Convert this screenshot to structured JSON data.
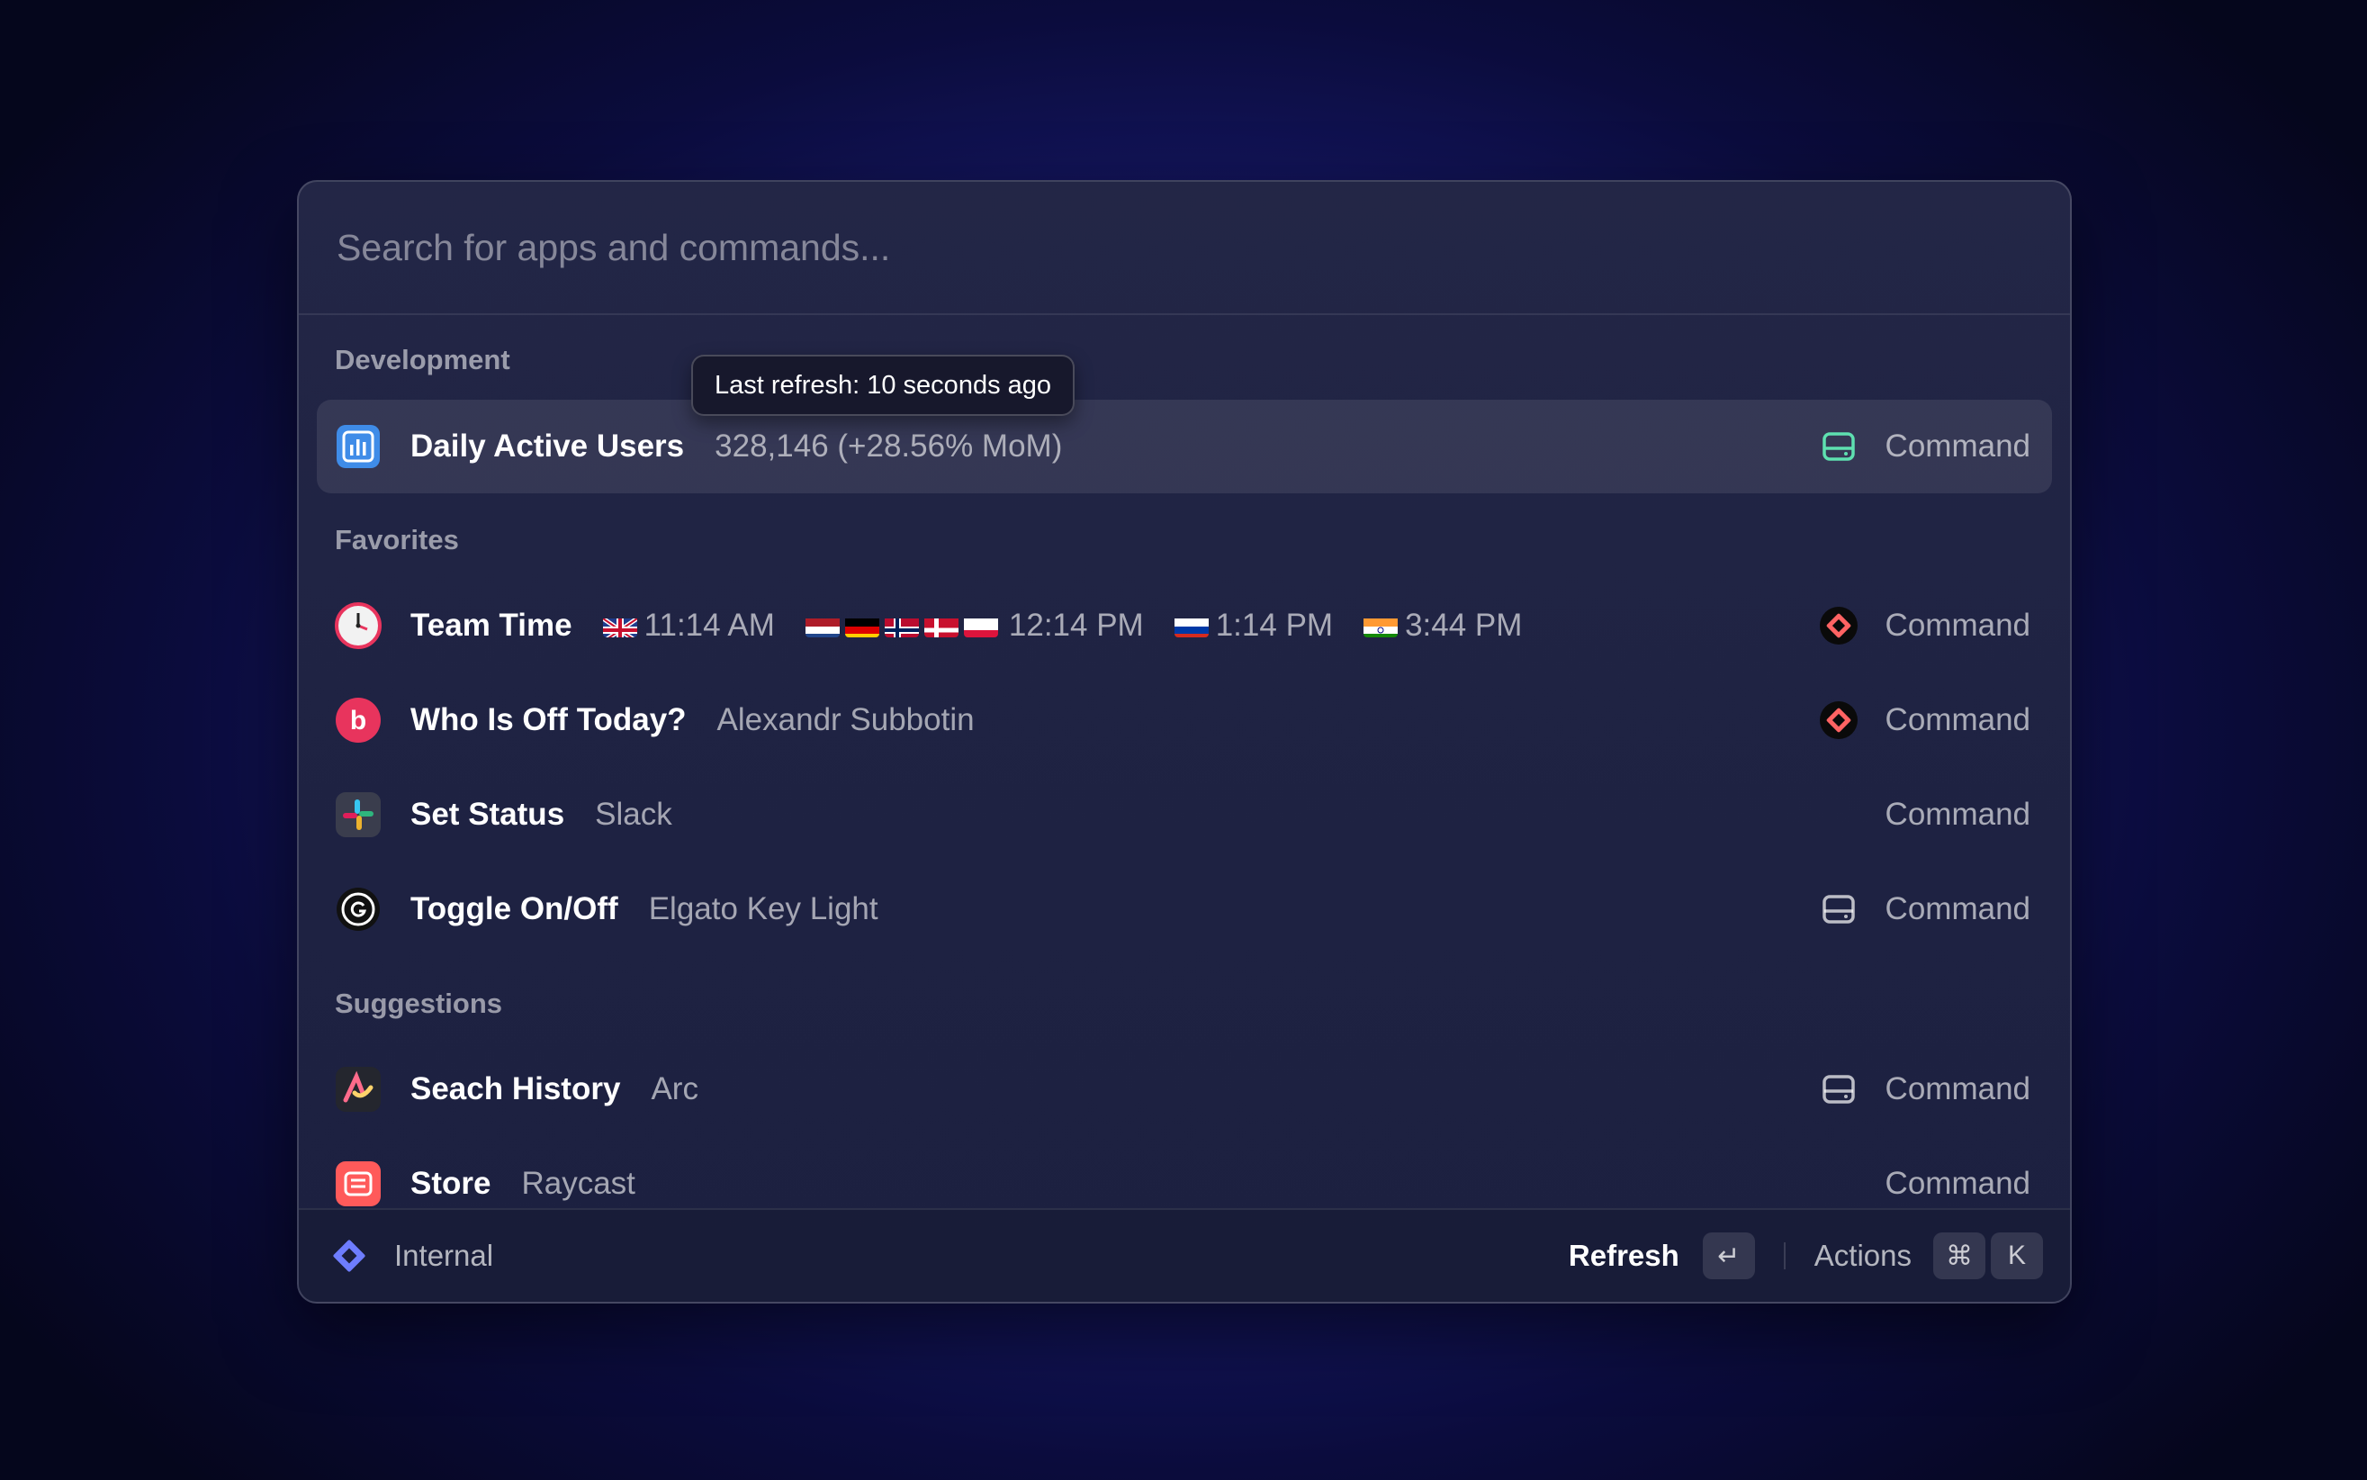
{
  "search": {
    "placeholder": "Search for apps and commands..."
  },
  "tooltip": "Last refresh: 10 seconds ago",
  "sections": {
    "development": "Development",
    "favorites": "Favorites",
    "suggestions": "Suggestions"
  },
  "rows": {
    "dau": {
      "title": "Daily Active Users",
      "subtitle": "328,146 (+28.56% MoM)",
      "kind": "Command",
      "icon": "chart-icon",
      "accessory": "drive-icon"
    },
    "team_time": {
      "title": "Team Time",
      "zones": [
        {
          "flags": [
            "uk"
          ],
          "time": "11:14 AM"
        },
        {
          "flags": [
            "nl",
            "de",
            "no",
            "dk",
            "pl"
          ],
          "time": "12:14 PM"
        },
        {
          "flags": [
            "ru"
          ],
          "time": "1:14 PM"
        },
        {
          "flags": [
            "in"
          ],
          "time": "3:44 PM"
        }
      ],
      "kind": "Command",
      "icon": "clock-icon",
      "accessory": "raycast-icon"
    },
    "who_off": {
      "title": "Who Is Off Today?",
      "subtitle": "Alexandr Subbotin",
      "kind": "Command",
      "icon": "bob-icon",
      "accessory": "raycast-icon"
    },
    "set_status": {
      "title": "Set Status",
      "subtitle": "Slack",
      "kind": "Command",
      "icon": "slack-icon"
    },
    "toggle": {
      "title": "Toggle On/Off",
      "subtitle": "Elgato Key Light",
      "kind": "Command",
      "icon": "elgato-icon",
      "accessory": "drive-icon"
    },
    "search_history": {
      "title": "Seach History",
      "subtitle": "Arc",
      "kind": "Command",
      "icon": "arc-icon",
      "accessory": "drive-icon"
    },
    "store": {
      "title": "Store",
      "subtitle": "Raycast",
      "kind": "Command",
      "icon": "store-icon"
    }
  },
  "footer": {
    "context": "Internal",
    "primary_action": "Refresh",
    "enter_key": "↵",
    "actions_label": "Actions",
    "cmd_key": "⌘",
    "k_key": "K"
  },
  "colors": {
    "accent_green": "#5ee0b0",
    "raycast_red": "#ff6363",
    "bob_pink": "#e8345d"
  }
}
